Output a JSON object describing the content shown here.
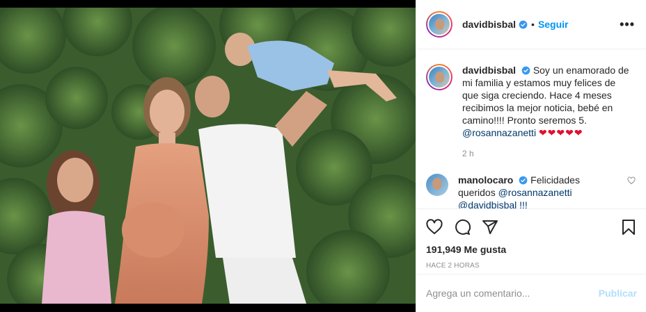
{
  "post": {
    "username": "davidbisbal",
    "follow_label": "Seguir",
    "separator": "•",
    "more_label": "•••"
  },
  "caption": {
    "username": "davidbisbal",
    "text": "Soy un enamorado de mi familia y estamos muy felices de que siga creciendo. Hace 4 meses recibimos la mejor noticia, bebé en camino!!!! Pronto seremos 5.",
    "mention": "@rosannazanetti",
    "hearts": "❤❤❤❤❤",
    "time": "2 h"
  },
  "comments": [
    {
      "username": "manolocaro",
      "text": "Felicidades queridos",
      "mention": "@rosannazanetti",
      "extra": "@davidbisbal !!!"
    }
  ],
  "actions": {
    "likes": "191,949 Me gusta",
    "ago": "HACE 2 HORAS"
  },
  "add_comment": {
    "placeholder": "Agrega un comentario...",
    "publish_label": "Publicar"
  },
  "colors": {
    "accent": "#0095f6",
    "publish_disabled": "#b2dffc",
    "heart": "#e0102f"
  }
}
